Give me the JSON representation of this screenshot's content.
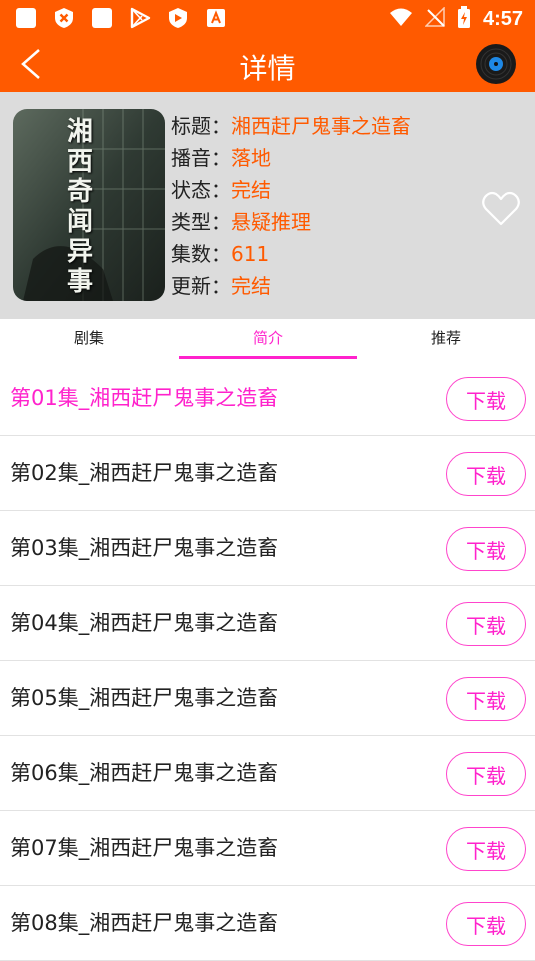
{
  "status_bar": {
    "time": "4:57"
  },
  "app_bar": {
    "title": "详情"
  },
  "book": {
    "cover_text": "湘西奇闻异事",
    "fields": [
      {
        "label": "标题：",
        "value": "湘西赶尸鬼事之造畜"
      },
      {
        "label": "播音：",
        "value": "落地"
      },
      {
        "label": "状态：",
        "value": "完结"
      },
      {
        "label": "类型：",
        "value": "悬疑推理"
      },
      {
        "label": "集数：",
        "value": "611"
      },
      {
        "label": "更新：",
        "value": "完结"
      }
    ]
  },
  "tabs": [
    {
      "label": "剧集"
    },
    {
      "label": "简介"
    },
    {
      "label": "推荐"
    }
  ],
  "episodes": [
    {
      "title": "第01集_湘西赶尸鬼事之造畜",
      "download": "下载"
    },
    {
      "title": "第02集_湘西赶尸鬼事之造畜",
      "download": "下载"
    },
    {
      "title": "第03集_湘西赶尸鬼事之造畜",
      "download": "下载"
    },
    {
      "title": "第04集_湘西赶尸鬼事之造畜",
      "download": "下载"
    },
    {
      "title": "第05集_湘西赶尸鬼事之造畜",
      "download": "下载"
    },
    {
      "title": "第06集_湘西赶尸鬼事之造畜",
      "download": "下载"
    },
    {
      "title": "第07集_湘西赶尸鬼事之造畜",
      "download": "下载"
    },
    {
      "title": "第08集_湘西赶尸鬼事之造畜",
      "download": "下载"
    }
  ],
  "colors": {
    "primary": "#ff5a00",
    "accent": "#ff22cc",
    "info_bg": "#dcdcdc"
  },
  "icons": [
    "back-arrow-icon",
    "vinyl-disc-icon",
    "heart-outline-icon",
    "wifi-icon",
    "signal-icon",
    "battery-icon"
  ]
}
